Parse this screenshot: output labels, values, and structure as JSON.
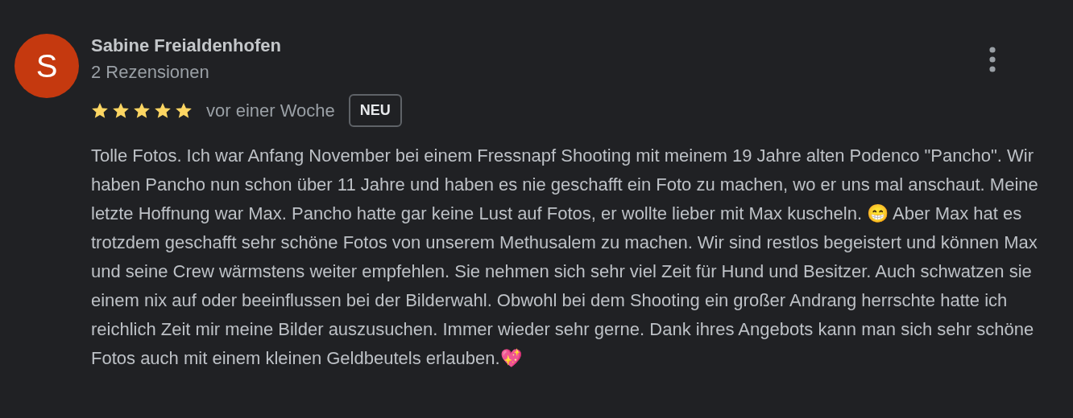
{
  "review": {
    "avatar_letter": "S",
    "author": "Sabine Freialdenhofen",
    "review_count": "2 Rezensionen",
    "stars": 5,
    "time": "vor einer Woche",
    "badge": "NEU",
    "text": "Tolle Fotos. Ich war Anfang November bei einem Fressnapf Shooting mit meinem 19 Jahre alten Podenco \"Pancho\". Wir haben Pancho nun schon über 11 Jahre und haben es nie geschafft ein Foto zu machen, wo er uns mal anschaut. Meine letzte Hoffnung war Max. Pancho hatte gar keine Lust auf Fotos, er wollte lieber mit Max kuscheln. 😁 Aber Max hat es trotzdem geschafft sehr schöne Fotos von unserem Methusalem zu machen. Wir sind restlos begeistert und können Max und seine Crew wärmstens weiter empfehlen. Sie nehmen sich sehr viel Zeit für Hund und Besitzer. Auch schwatzen sie einem nix auf oder beeinflussen bei der Bilderwahl. Obwohl bei dem Shooting ein großer Andrang herrschte hatte ich reichlich Zeit mir meine Bilder auszusuchen. Immer wieder sehr gerne. Dank ihres Angebots kann man sich sehr schöne Fotos auch mit einem kleinen Geldbeutels erlauben.💖"
  }
}
